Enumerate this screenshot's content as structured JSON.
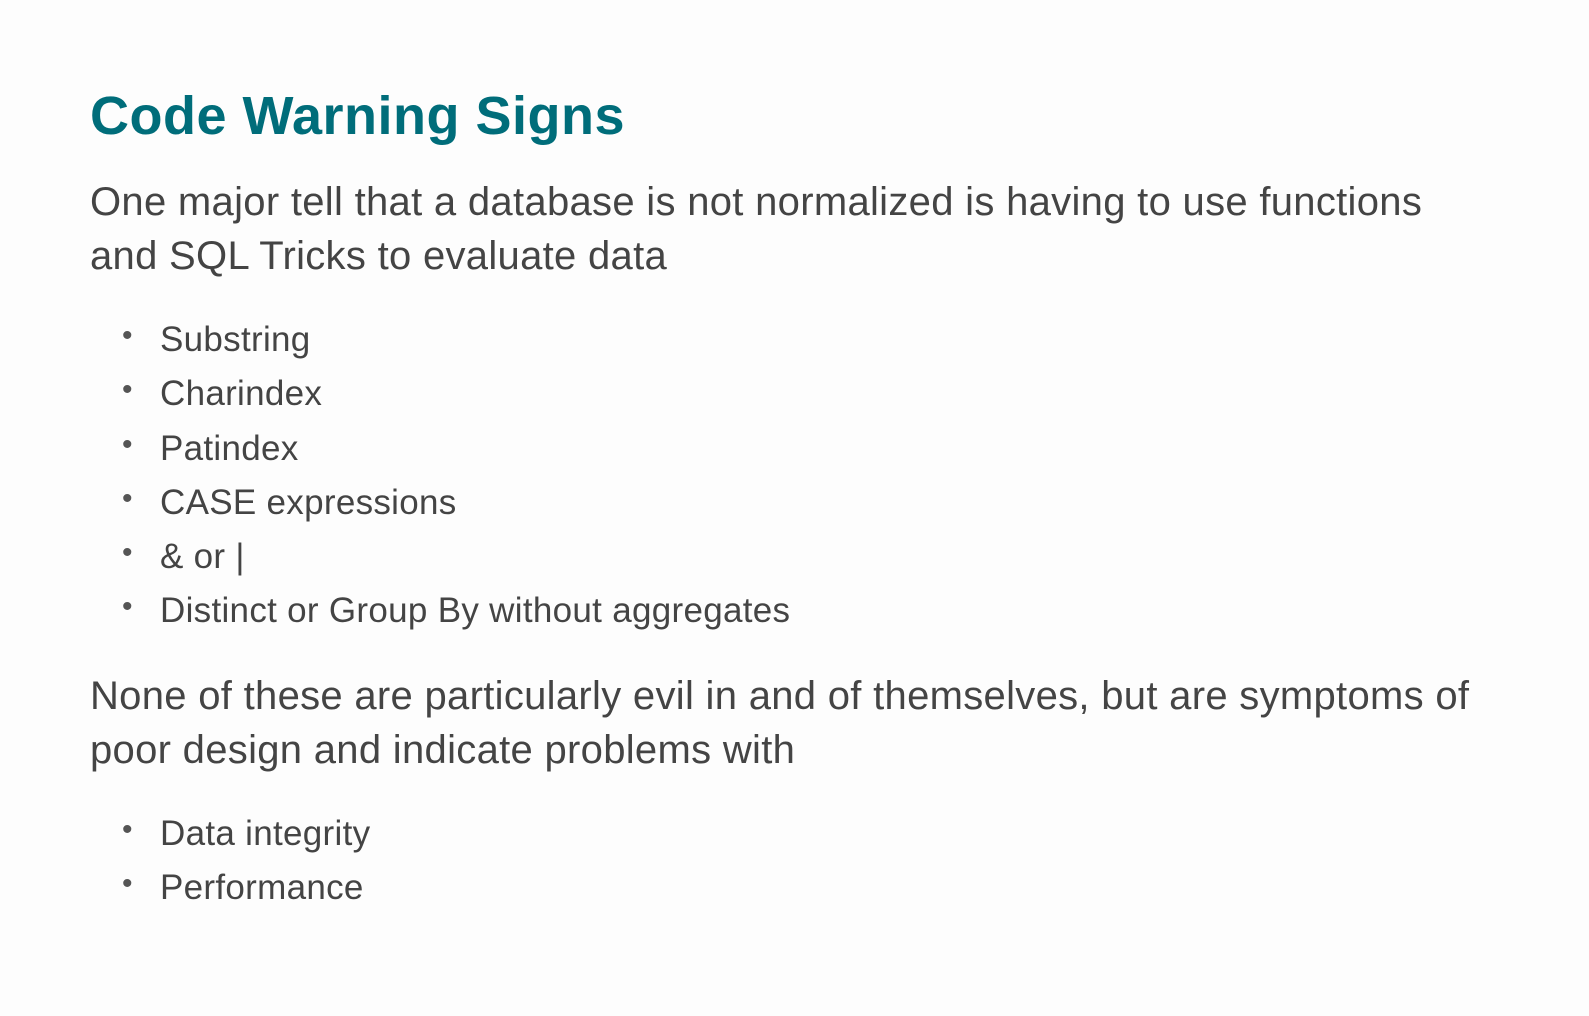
{
  "slide": {
    "title": "Code Warning Signs",
    "intro": "One major tell that a database is not normalized is having to use functions and SQL Tricks to evaluate data",
    "list1": [
      "Substring",
      "Charindex",
      "Patindex",
      "CASE expressions",
      "& or |",
      "Distinct or Group By without aggregates"
    ],
    "middle": "None of these are particularly evil in and of themselves, but are symptoms of poor design and indicate problems with",
    "list2": [
      "Data integrity",
      "Performance"
    ]
  }
}
